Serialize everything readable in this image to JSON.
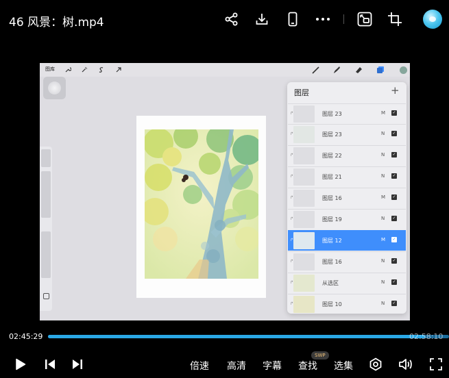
{
  "header": {
    "title": "46 风景：树.mp4",
    "icons": [
      "share-icon",
      "download-icon",
      "phone-icon",
      "more-icon",
      "screen-cast-icon",
      "crop-icon"
    ]
  },
  "procreate": {
    "gallery_label": "图库",
    "color_swatch": "#86a69c",
    "layers_panel": {
      "title": "图层",
      "add_symbol": "+",
      "layers": [
        {
          "name": "图层 23",
          "mode": "M",
          "selected": false
        },
        {
          "name": "图层 23",
          "mode": "N",
          "selected": false
        },
        {
          "name": "图层 22",
          "mode": "N",
          "selected": false
        },
        {
          "name": "图层 21",
          "mode": "N",
          "selected": false
        },
        {
          "name": "图层 16",
          "mode": "M",
          "selected": false
        },
        {
          "name": "图层 19",
          "mode": "N",
          "selected": false
        },
        {
          "name": "图层 12",
          "mode": "M",
          "selected": true
        },
        {
          "name": "图层 16",
          "mode": "N",
          "selected": false
        },
        {
          "name": "从选区",
          "mode": "N",
          "selected": false
        },
        {
          "name": "图层 10",
          "mode": "N",
          "selected": false
        }
      ]
    }
  },
  "player": {
    "current_time": "02:45:29",
    "total_time": "02:58:10",
    "progress": 0.94,
    "accent_color": "#2aa8e6",
    "controls": {
      "speed": "倍速",
      "quality": "高清",
      "subtitle": "字幕",
      "find": "查找",
      "find_badge": "SWP",
      "episodes": "选集"
    }
  }
}
